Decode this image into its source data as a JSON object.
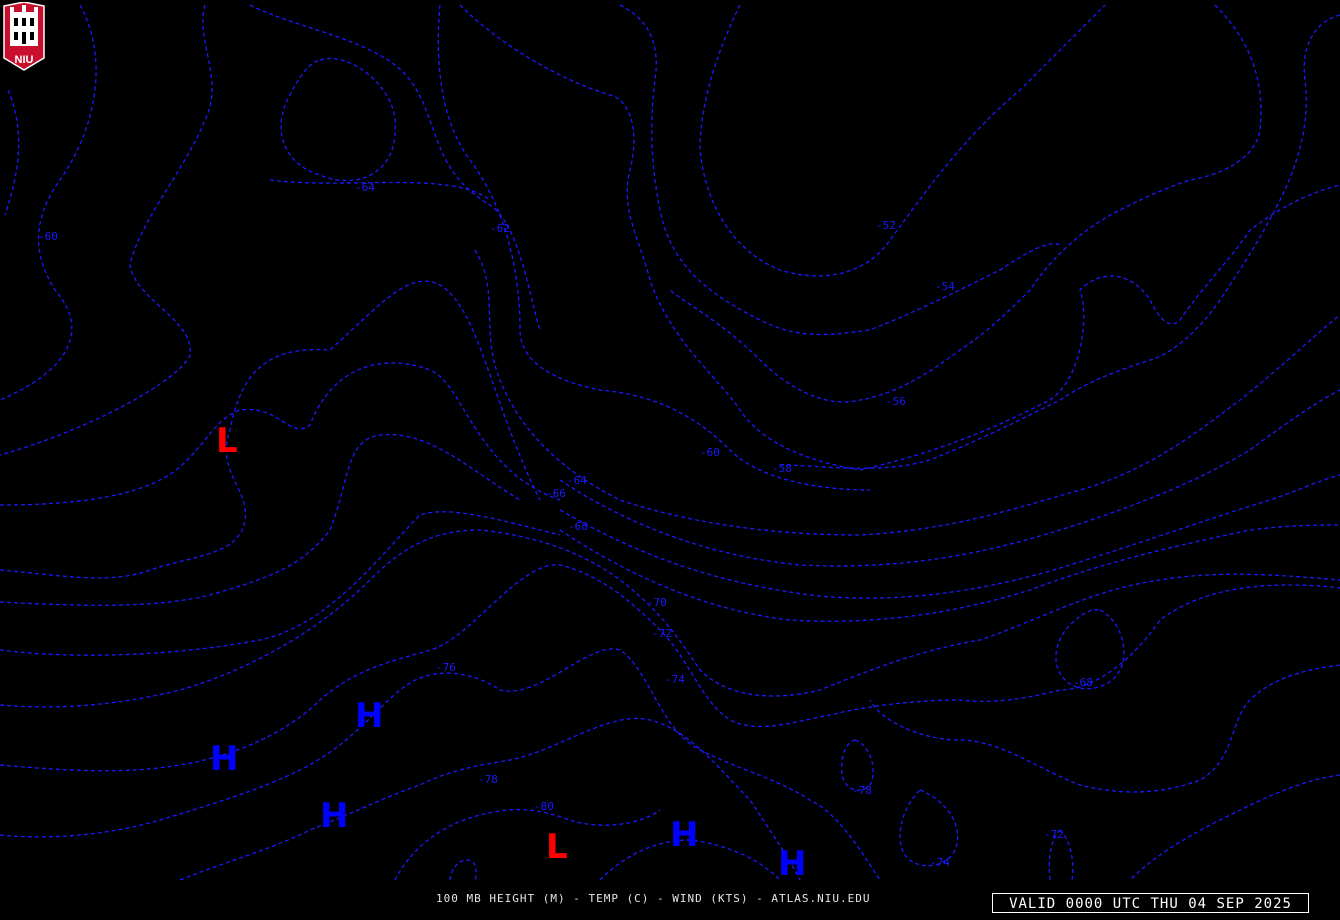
{
  "logo_text": "NIU",
  "footer_text": "100 MB HEIGHT (M) - TEMP (C) - WIND (KTS) - ATLAS.NIU.EDU",
  "valid_text": "VALID 0000 UTC THU 04 SEP 2025",
  "colors": {
    "isotherm": "#1a1aff",
    "high": "#0000ff",
    "low": "#ff0000",
    "background": "#000000"
  },
  "isotherm_labels": [
    "-64",
    "-60",
    "-62",
    "-52",
    "-54",
    "-56",
    "-60",
    "-58",
    "-64",
    "-66",
    "-68",
    "-70",
    "-72",
    "-74",
    "-76",
    "-78",
    "-80",
    "-78",
    "-74",
    "-72",
    "-68"
  ],
  "pressure_centers": [
    "L",
    "H",
    "H",
    "H",
    "L",
    "H",
    "H"
  ]
}
